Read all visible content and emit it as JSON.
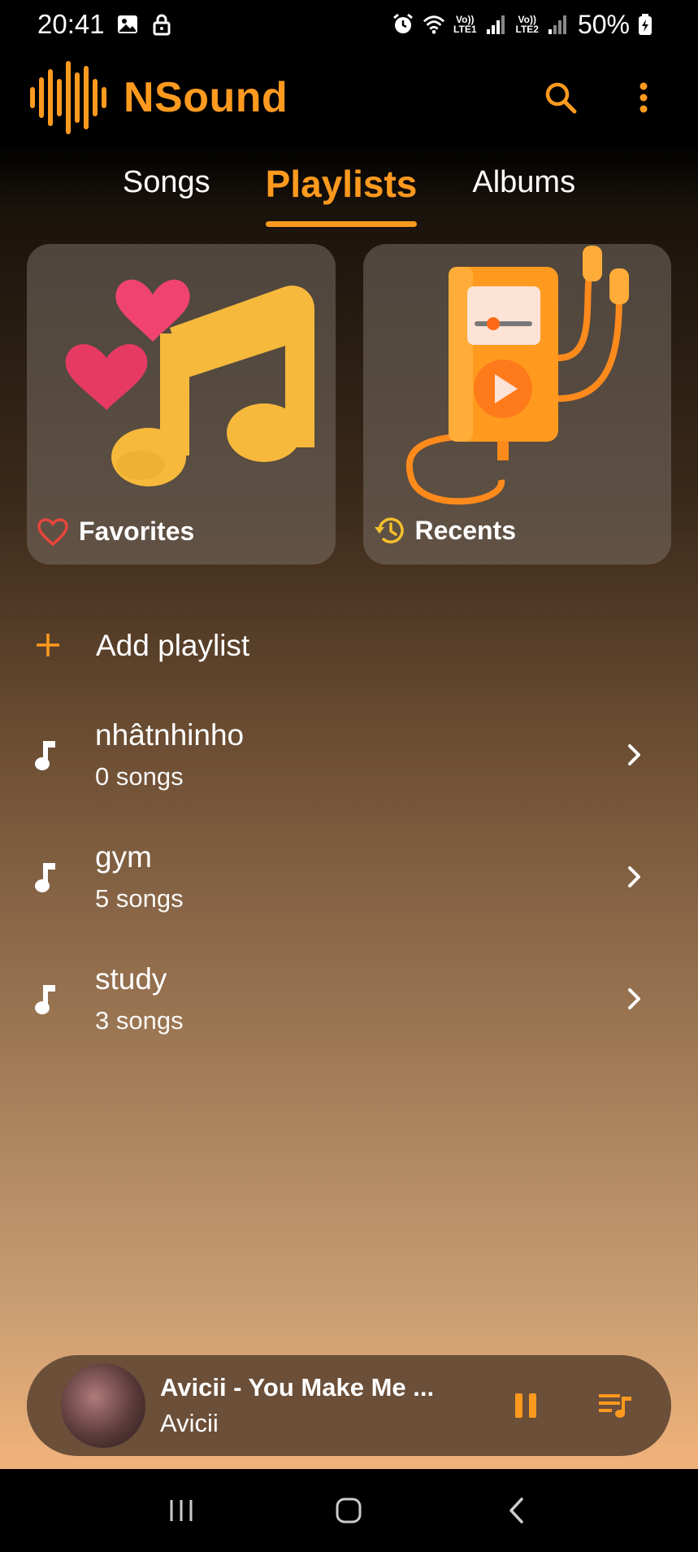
{
  "status": {
    "time": "20:41",
    "battery": "50%",
    "lte1": "LTE1",
    "lte2": "LTE2",
    "volte": "Vo))"
  },
  "header": {
    "title": "NSound",
    "brand_color": "#ff9a1f"
  },
  "tabs": [
    {
      "label": "Songs",
      "active": false
    },
    {
      "label": "Playlists",
      "active": true
    },
    {
      "label": "Albums",
      "active": false
    }
  ],
  "cards": {
    "favorites": {
      "label": "Favorites",
      "icon": "heart-outline-icon"
    },
    "recents": {
      "label": "Recents",
      "icon": "history-icon"
    }
  },
  "list": {
    "add_label": "Add playlist",
    "playlists": [
      {
        "name": "nhâtnhinho",
        "count": "0 songs"
      },
      {
        "name": "gym",
        "count": "5 songs"
      },
      {
        "name": "study",
        "count": "3 songs"
      }
    ]
  },
  "player": {
    "title": "Avicii - You Make Me ...",
    "artist": "Avicii"
  }
}
